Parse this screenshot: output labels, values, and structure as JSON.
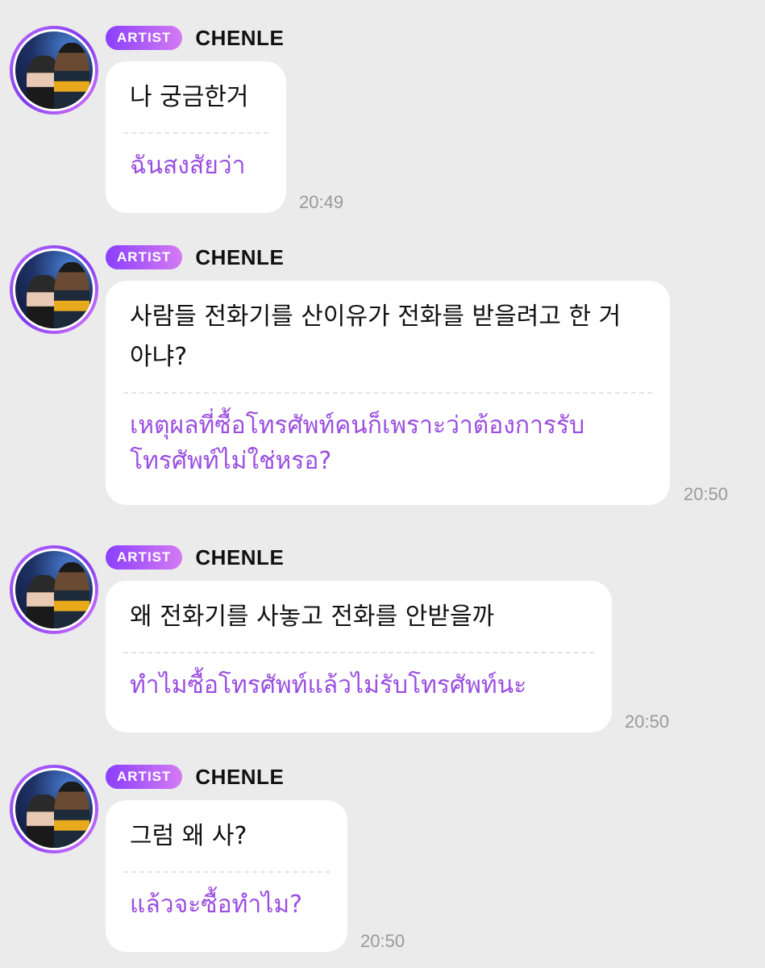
{
  "messages": [
    {
      "badge": "ARTIST",
      "sender": "CHENLE",
      "original": "나 궁금한거",
      "translation": "ฉันสงสัยว่า",
      "time": "20:49"
    },
    {
      "badge": "ARTIST",
      "sender": "CHENLE",
      "original": "사람들 전화기를 산이유가 전화를 받을려고 한 거 아냐?",
      "translation": "เหตุผลที่ซื้อโทรศัพท์คนก็เพราะว่าต้องการรับโทรศัพท์ไม่ใช่หรอ?",
      "time": "20:50"
    },
    {
      "badge": "ARTIST",
      "sender": "CHENLE",
      "original": "왜 전화기를 사놓고 전화를 안받을까",
      "translation": "ทำไมซื้อโทรศัพท์แล้วไม่รับโทรศัพท์นะ",
      "time": "20:50"
    },
    {
      "badge": "ARTIST",
      "sender": "CHENLE",
      "original": "그럼 왜 사?",
      "translation": "แล้วจะซื้อทำไม?",
      "time": "20:50"
    }
  ]
}
